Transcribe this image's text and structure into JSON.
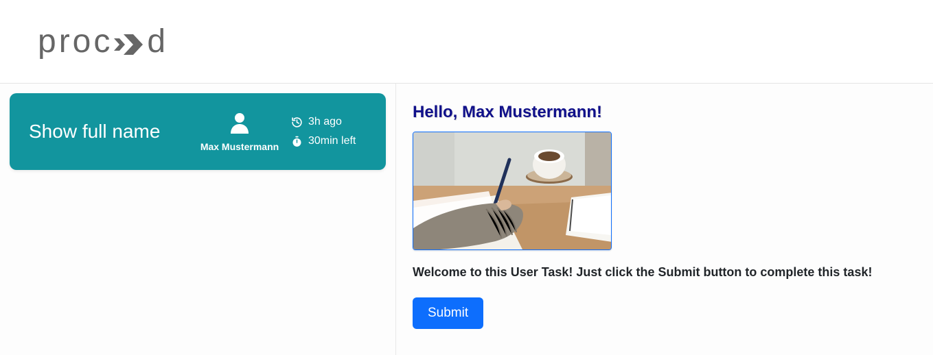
{
  "brand": {
    "name": "proceed",
    "display_left": "proc",
    "display_right": "d"
  },
  "sidebar": {
    "task": {
      "title": "Show full name",
      "assignee": "Max Mustermann",
      "created_ago": "3h ago",
      "time_left": "30min left"
    }
  },
  "main": {
    "greeting": "Hello, Max Mustermann!",
    "welcome_text": "Welcome to this User Task! Just click the Submit button to complete this task!",
    "submit_label": "Submit"
  },
  "colors": {
    "card_bg": "#12959e",
    "primary": "#0d6efd",
    "heading": "#10108a",
    "logo": "#666666"
  }
}
